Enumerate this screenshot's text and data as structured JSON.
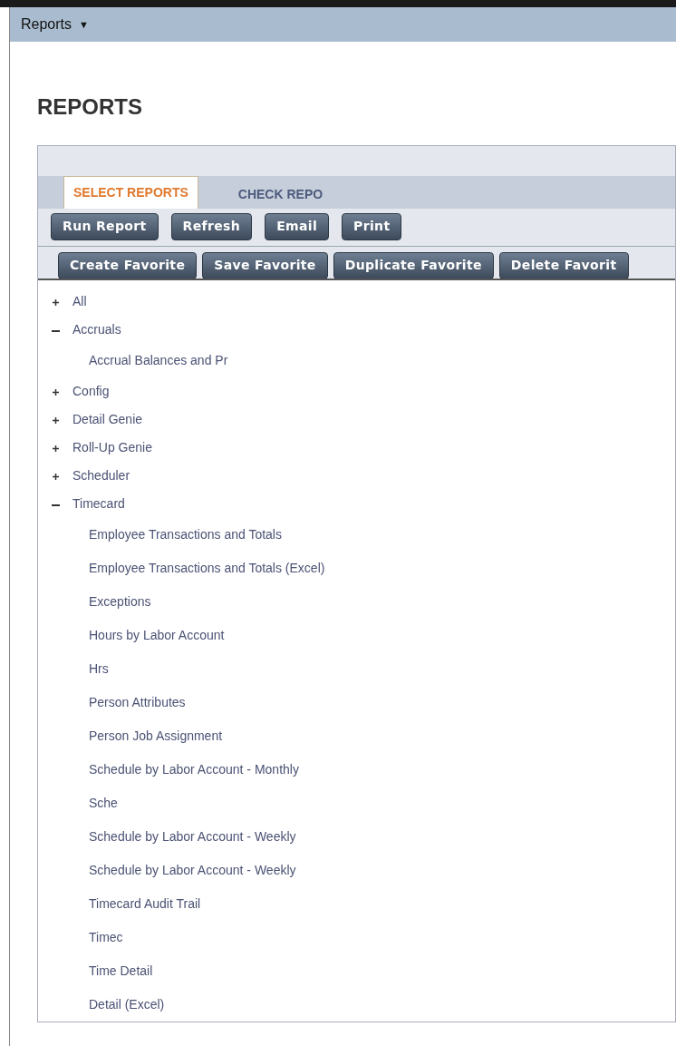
{
  "menu": {
    "label": "Reports",
    "caret": "▼"
  },
  "page_title": "REPORTS",
  "tabs": [
    {
      "label": "SELECT REPORTS",
      "selected": true
    },
    {
      "label": "CHECK REPO",
      "selected": false
    }
  ],
  "toolbar_rows": [
    [
      "Run Report",
      "Refresh",
      "Email",
      "Print"
    ],
    [
      "Create Favorite",
      "Save Favorite",
      "Duplicate Favorite",
      "Delete Favorit"
    ]
  ],
  "tree": [
    {
      "label": "All",
      "expanded": false
    },
    {
      "label": "Accruals",
      "expanded": true,
      "children": [
        {
          "label": "Accrual Balances and Pr"
        }
      ]
    },
    {
      "label": "Config",
      "expanded": false
    },
    {
      "label": "Detail Genie",
      "expanded": false
    },
    {
      "label": "Roll-Up Genie",
      "expanded": false
    },
    {
      "label": "Scheduler",
      "expanded": false
    },
    {
      "label": "Timecard",
      "expanded": true,
      "children": [
        {
          "label": "Employee Transactions and Totals"
        },
        {
          "label": "Employee Transactions and Totals (Excel)"
        },
        {
          "label": "Exceptions"
        },
        {
          "label": "Hours by Labor Account"
        },
        {
          "label": "Hrs"
        },
        {
          "label": "Person Attributes"
        },
        {
          "label": "Person Job Assignment"
        },
        {
          "label": "Schedule by Labor Account - Monthly"
        },
        {
          "label": "Sche"
        },
        {
          "label": "Schedule by Labor Account - Weekly"
        },
        {
          "label": "Schedule by Labor Account - Weekly"
        },
        {
          "label": "Timecard Audit Trail"
        },
        {
          "label": "Timec"
        },
        {
          "label": "Time Detail"
        },
        {
          "label": "Detail (Excel)"
        }
      ]
    }
  ]
}
